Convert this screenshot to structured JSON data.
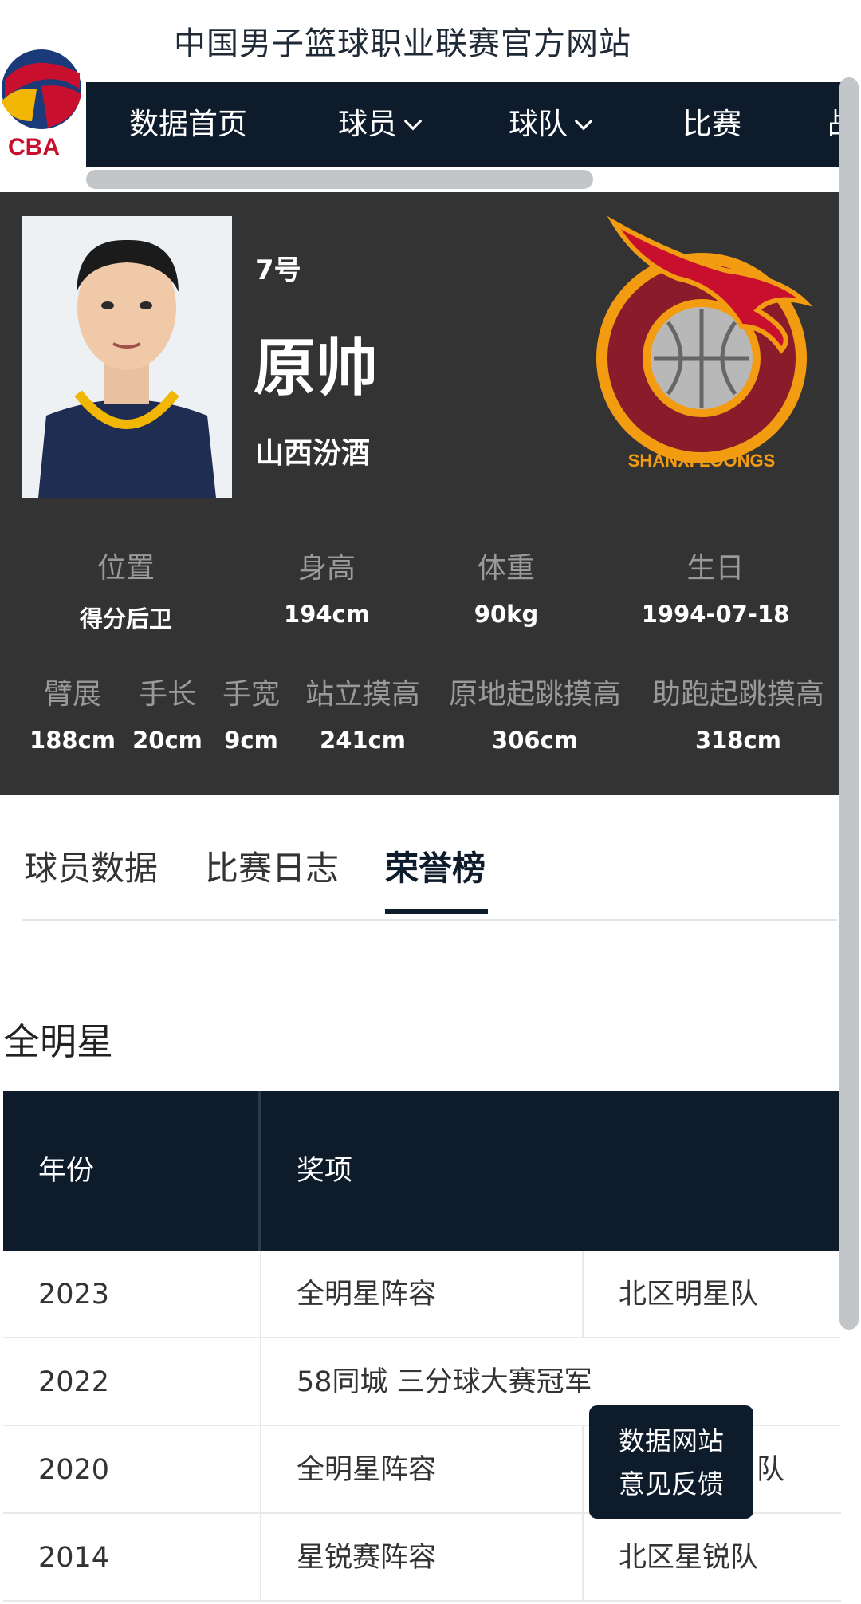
{
  "header": {
    "site_title": "中国男子篮球职业联赛官方网站",
    "logo_text": "CBA",
    "nav": [
      {
        "label": "数据首页",
        "dropdown": false
      },
      {
        "label": "球员",
        "dropdown": true
      },
      {
        "label": "球队",
        "dropdown": true
      },
      {
        "label": "比赛",
        "dropdown": false
      },
      {
        "label": "战",
        "dropdown": false
      }
    ]
  },
  "player": {
    "number": "7号",
    "name": "原帅",
    "team": "山西汾酒",
    "team_logo_text": "SHANXI LOONGS",
    "stats_row1": [
      {
        "label": "位置",
        "value": "得分后卫"
      },
      {
        "label": "身高",
        "value": "194cm"
      },
      {
        "label": "体重",
        "value": "90kg"
      },
      {
        "label": "生日",
        "value": "1994-07-18"
      }
    ],
    "stats_row2": [
      {
        "label": "臂展",
        "value": "188cm"
      },
      {
        "label": "手长",
        "value": "20cm"
      },
      {
        "label": "手宽",
        "value": "9cm"
      },
      {
        "label": "站立摸高",
        "value": "241cm"
      },
      {
        "label": "原地起跳摸高",
        "value": "306cm"
      },
      {
        "label": "助跑起跳摸高",
        "value": "318cm"
      }
    ]
  },
  "tabs": [
    {
      "label": "球员数据",
      "active": false
    },
    {
      "label": "比赛日志",
      "active": false
    },
    {
      "label": "荣誉榜",
      "active": true
    }
  ],
  "honors": {
    "section_title": "全明星",
    "columns": [
      "年份",
      "奖项"
    ],
    "rows": [
      {
        "year": "2023",
        "award": "全明星阵容",
        "team": "北区明星队"
      },
      {
        "year": "2022",
        "award": "58同城 三分球大赛冠军",
        "team": ""
      },
      {
        "year": "2020",
        "award": "全明星阵容",
        "team": "队"
      },
      {
        "year": "2014",
        "award": "星锐赛阵容",
        "team": "北区星锐队"
      }
    ]
  },
  "feedback": {
    "line1": "数据网站",
    "line2": "意见反馈"
  },
  "colors": {
    "navy": "#0d1b2a",
    "panel": "#333333",
    "brand_red": "#c8102e",
    "dragon_orange": "#f39c12"
  }
}
